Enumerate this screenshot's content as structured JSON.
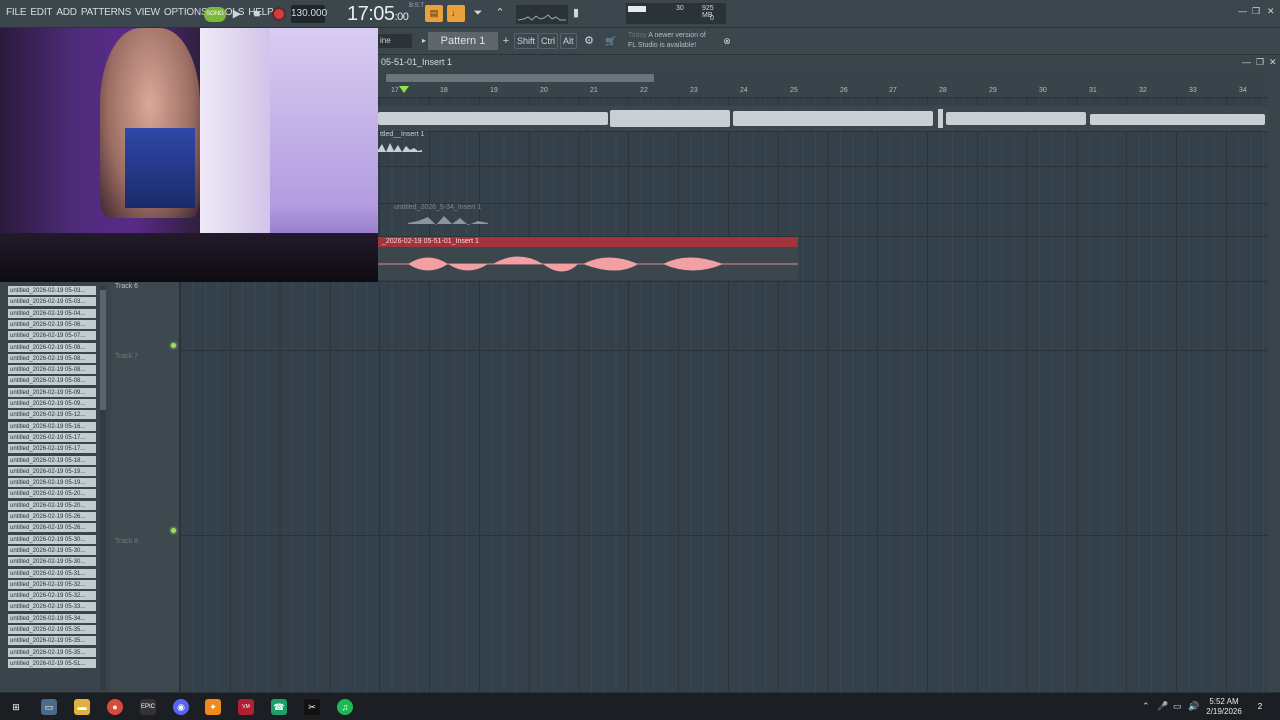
{
  "menu": [
    "FILE",
    "EDIT",
    "ADD",
    "PATTERNS",
    "VIEW",
    "OPTIONS",
    "TOOLS",
    "HELP"
  ],
  "transport": {
    "song_label": "SONG",
    "tempo": "130.000",
    "time": "17:05",
    "time_ticks": ":00",
    "time_sig": "B:S:T",
    "cpu_value": "30",
    "memory": "925 MB",
    "polyphony": "0"
  },
  "toolbar2": {
    "snap": "ine",
    "pattern": "Pattern 1",
    "shift_label": "Shift",
    "ctrl_label": "Ctrl",
    "alt_label": "Alt",
    "news_today": "Today",
    "news_line1": "A newer version of",
    "news_line2": "FL Studio is available!"
  },
  "playlist": {
    "title": "05-51-01_Insert 1",
    "bars": [
      "17",
      "18",
      "19",
      "20",
      "21",
      "22",
      "23",
      "24",
      "25",
      "26",
      "27",
      "28",
      "29",
      "30",
      "31",
      "32",
      "33",
      "34"
    ],
    "clip_small_label": "ttled__Insert 1",
    "clip_ghost_label": "untitled_2026_5-34_Insert 1",
    "clip_red_label": "_2026-02-19 05-51-01_Insert 1"
  },
  "tracks": [
    {
      "name": "Track 6",
      "dim": false
    },
    {
      "name": "Track 7",
      "dim": true
    },
    {
      "name": "Track 8",
      "dim": true
    }
  ],
  "browser_files": [
    "untitled_2026-02-19 05-03...",
    "untitled_2026-02-19 05-03...",
    "untitled_2026-02-19 05-04...",
    "untitled_2026-02-19 05-06...",
    "untitled_2026-02-19 05-07...",
    "untitled_2026-02-19 05-08...",
    "untitled_2026-02-19 05-08...",
    "untitled_2026-02-19 05-08...",
    "untitled_2026-02-19 05-08...",
    "untitled_2026-02-19 05-09...",
    "untitled_2026-02-19 05-09...",
    "untitled_2026-02-19 05-12...",
    "untitled_2026-02-19 05-16...",
    "untitled_2026-02-19 05-17...",
    "untitled_2026-02-19 05-17...",
    "untitled_2026-02-19 05-18...",
    "untitled_2026-02-19 05-19...",
    "untitled_2026-02-19 05-19...",
    "untitled_2026-02-19 05-20...",
    "untitled_2026-02-19 05-20...",
    "untitled_2026-02-19 05-26...",
    "untitled_2026-02-19 05-26...",
    "untitled_2026-02-19 05-30...",
    "untitled_2026-02-19 05-30...",
    "untitled_2026-02-19 05-30...",
    "untitled_2026-02-19 05-31...",
    "untitled_2026-02-19 05-32...",
    "untitled_2026-02-19 05-32...",
    "untitled_2026-02-19 05-33...",
    "untitled_2026-02-19 05-34...",
    "untitled_2026-02-19 05-35...",
    "untitled_2026-02-19 05-35...",
    "untitled_2026-02-19 05-35...",
    "untitled_2026-02-19 05-51..."
  ],
  "taskbar": {
    "time": "5:52 AM",
    "date": "2/19/2026",
    "notif_count": "2",
    "icons": [
      "windows-start-icon",
      "file-explorer-icon",
      "folder-icon",
      "chrome-icon",
      "epic-games-icon",
      "discord-icon",
      "fl-studio-icon",
      "voicemeeter-icon",
      "whatsapp-icon",
      "capcut-icon",
      "spotify-icon"
    ]
  },
  "colors": {
    "accent_green": "#8fe34b",
    "record_red": "#d04040",
    "clip_red": "#a3333d",
    "orange": "#e9a23b"
  }
}
